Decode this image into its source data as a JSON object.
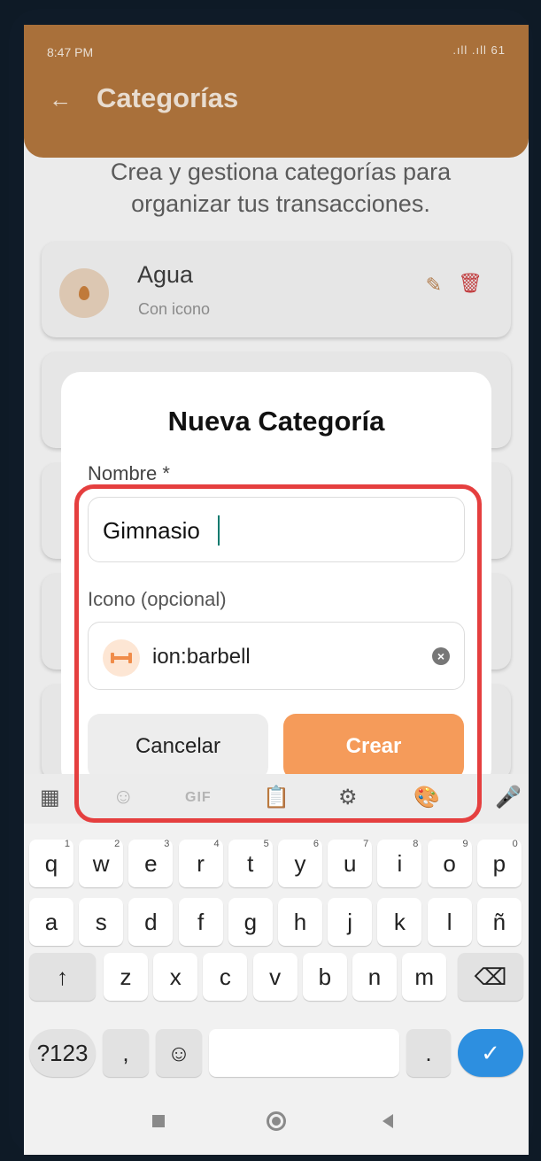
{
  "status_bar": {
    "time": "8:47 PM",
    "right": ".ıll .ıll 61"
  },
  "app_bar": {
    "title": "Categorías"
  },
  "page": {
    "subtitle": "Crea y gestiona categorías para organizar tus transacciones."
  },
  "categories": [
    {
      "name": "Agua",
      "subtitle": "Con icono"
    }
  ],
  "modal": {
    "title": "Nueva Categoría",
    "name_label": "Nombre *",
    "name_value": "Gimnasio",
    "icon_label": "Icono (opcional)",
    "icon_value": "ion:barbell",
    "cancel_label": "Cancelar",
    "create_label": "Crear"
  },
  "keyboard": {
    "toolbar_gif": "GIF",
    "row1": [
      {
        "k": "q",
        "h": "1"
      },
      {
        "k": "w",
        "h": "2"
      },
      {
        "k": "e",
        "h": "3"
      },
      {
        "k": "r",
        "h": "4"
      },
      {
        "k": "t",
        "h": "5"
      },
      {
        "k": "y",
        "h": "6"
      },
      {
        "k": "u",
        "h": "7"
      },
      {
        "k": "i",
        "h": "8"
      },
      {
        "k": "o",
        "h": "9"
      },
      {
        "k": "p",
        "h": "0"
      }
    ],
    "row2": [
      "a",
      "s",
      "d",
      "f",
      "g",
      "h",
      "j",
      "k",
      "l",
      "ñ"
    ],
    "row3": [
      "z",
      "x",
      "c",
      "v",
      "b",
      "n",
      "m"
    ],
    "shift": "↑",
    "backspace": "⌫",
    "numbers": "?123",
    "comma": ",",
    "emoji": "☺",
    "period": ".",
    "enter": "✓"
  },
  "colors": {
    "accent": "#f59b5a",
    "appbar": "#a9703a",
    "highlight": "#e53f3f",
    "enter_key": "#2d8fe0"
  }
}
